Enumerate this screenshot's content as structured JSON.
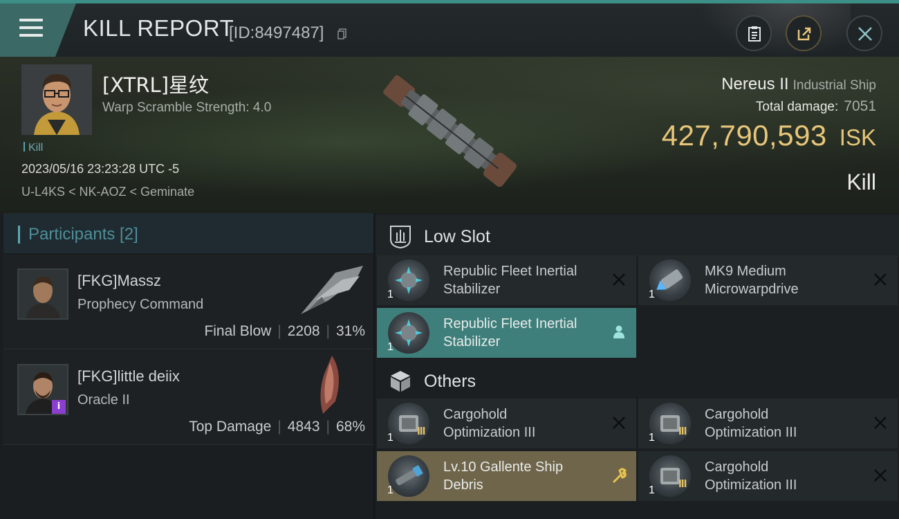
{
  "header": {
    "title": "KILL REPORT",
    "report_id": "[ID:8497487]",
    "icons": [
      "menu-icon",
      "copy-icon",
      "clipboard-icon",
      "share-icon",
      "close-icon"
    ]
  },
  "victim": {
    "name": "[XTRL]星纹",
    "warp_scramble": "Warp Scramble Strength: 4.0",
    "tag": "Kill",
    "datetime": "2023/05/16 23:23:28 UTC -5",
    "location": "U-L4KS < NK-AOZ < Geminate",
    "ship_name": "Nereus II",
    "ship_class": "Industrial Ship",
    "total_damage_label": "Total damage:",
    "total_damage": "7051",
    "isk_value": "427,790,593",
    "isk_unit": "ISK",
    "result": "Kill"
  },
  "participants": {
    "title": "Participants [2]",
    "rows": [
      {
        "name": "[FKG]Massz",
        "ship": "Prophecy Command",
        "role": "Final Blow",
        "damage": "2208",
        "percent": "31%"
      },
      {
        "name": "[FKG]little deiix",
        "ship": "Oracle II",
        "role": "Top Damage",
        "damage": "4843",
        "percent": "68%"
      }
    ]
  },
  "fittings": {
    "low_slot": {
      "label": "Low Slot",
      "items": [
        {
          "name_line1": "Republic Fleet Inertial",
          "name_line2": "Stabilizer",
          "qty": "1",
          "status": "destroyed"
        },
        {
          "name_line1": "MK9 Medium",
          "name_line2": "Microwarpdrive",
          "qty": "1",
          "status": "destroyed"
        },
        {
          "name_line1": "Republic Fleet Inertial",
          "name_line2": "Stabilizer",
          "qty": "1",
          "status": "dropped"
        }
      ]
    },
    "others": {
      "label": "Others",
      "items": [
        {
          "name_line1": "Cargohold",
          "name_line2": "Optimization III",
          "qty": "1",
          "status": "destroyed"
        },
        {
          "name_line1": "Cargohold",
          "name_line2": "Optimization III",
          "qty": "1",
          "status": "destroyed"
        },
        {
          "name_line1": "Lv.10 Gallente Ship",
          "name_line2": "Debris",
          "qty": "1",
          "status": "salvage"
        },
        {
          "name_line1": "Cargohold",
          "name_line2": "Optimization III",
          "qty": "1",
          "status": "destroyed"
        }
      ]
    }
  },
  "colors": {
    "accent_teal": "#3b8f86",
    "isk_gold": "#e7c67a",
    "dropped_highlight": "#3f7f7b",
    "salvage_highlight": "#6f654a"
  }
}
